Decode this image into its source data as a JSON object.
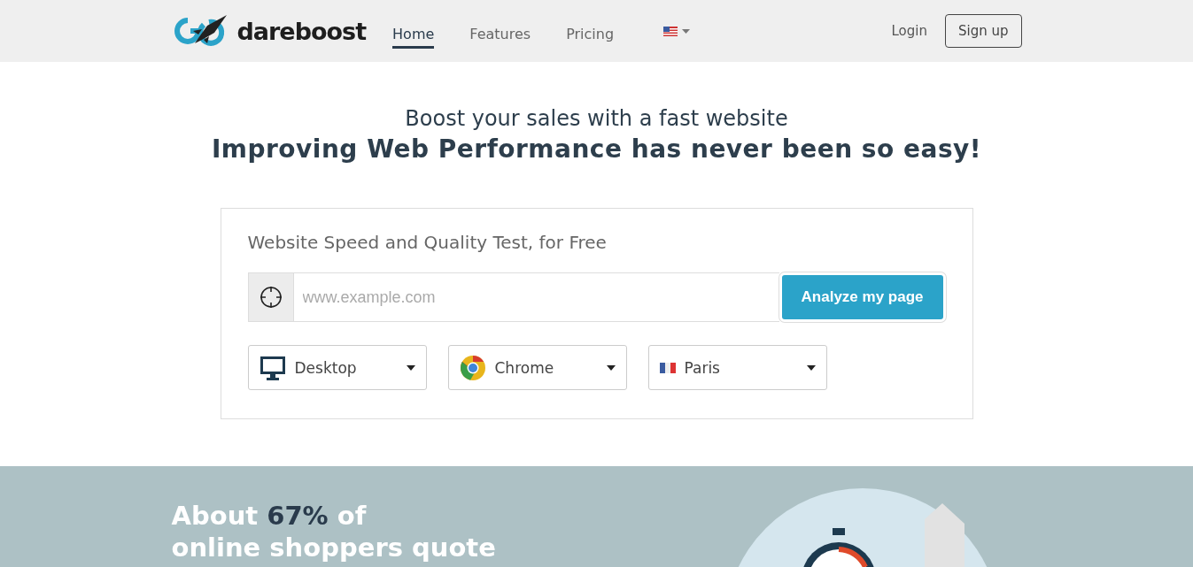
{
  "header": {
    "logo": "dareboost",
    "nav": [
      {
        "label": "Home",
        "selected": true
      },
      {
        "label": "Features",
        "selected": false
      },
      {
        "label": "Pricing",
        "selected": false
      }
    ],
    "login": "Login",
    "signup": "Sign up"
  },
  "hero": {
    "subtitle": "Boost your sales with a fast website",
    "title": "Improving Web Performance has never been so easy!"
  },
  "test": {
    "title": "Website Speed and Quality Test, for Free",
    "placeholder": "www.example.com",
    "button": "Analyze my page",
    "selects": [
      {
        "kind": "device",
        "label": "Desktop"
      },
      {
        "kind": "browser",
        "label": "Chrome"
      },
      {
        "kind": "location",
        "label": "Paris"
      }
    ]
  },
  "stat": {
    "prefix": "About",
    "highlight": "67%",
    "suffix": "of",
    "line2": "online shoppers quote"
  }
}
